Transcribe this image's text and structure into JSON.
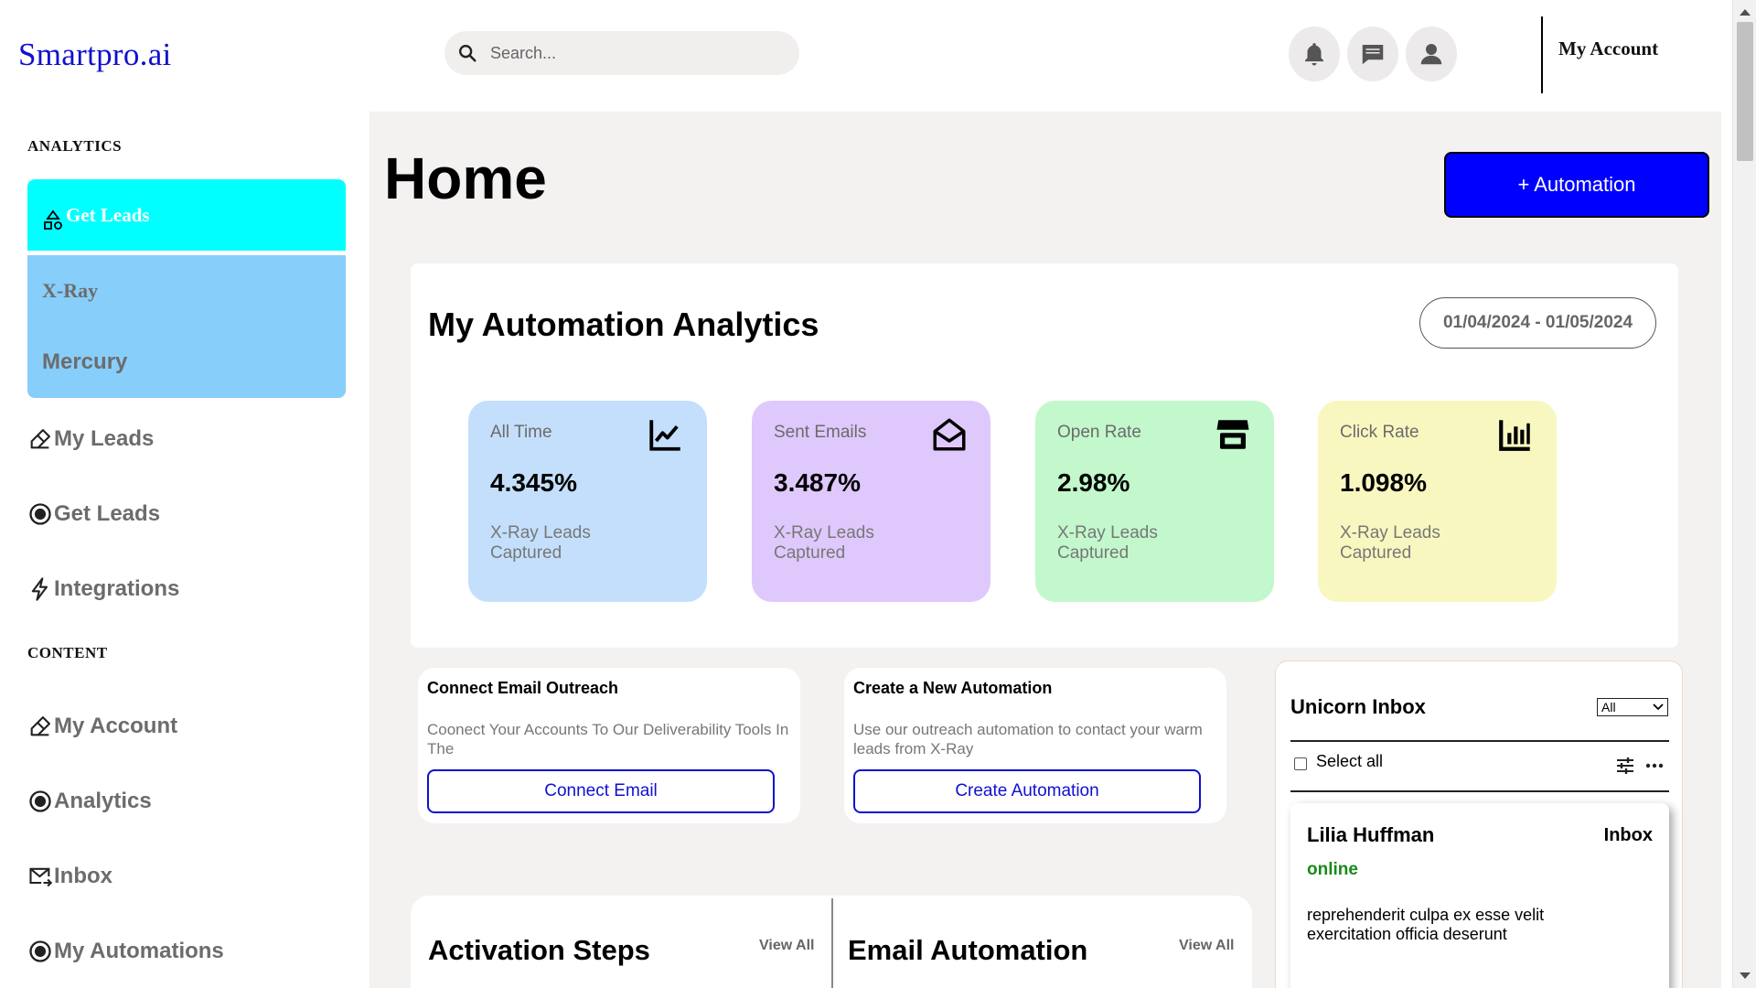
{
  "header": {
    "logo": "Smartpro.ai",
    "search_placeholder": "Search...",
    "account_label": "My Account",
    "icons": [
      "bell-icon",
      "chat-icon",
      "user-icon",
      "search-icon"
    ]
  },
  "sidebar": {
    "section_analytics": "ANALYTICS",
    "section_content": "CONTENT",
    "group": {
      "active": "Get Leads",
      "xray": "X-Ray",
      "mercury": "Mercury"
    },
    "analytics_items": [
      {
        "label": "My Leads",
        "icon": "eraser-icon"
      },
      {
        "label": "Get Leads",
        "icon": "radio-icon"
      },
      {
        "label": "Integrations",
        "icon": "lightning-icon"
      }
    ],
    "content_items": [
      {
        "label": "My Account",
        "icon": "eraser-icon"
      },
      {
        "label": "Analytics",
        "icon": "radio-icon"
      },
      {
        "label": "Inbox",
        "icon": "mail-forward-icon"
      },
      {
        "label": "My Automations",
        "icon": "radio-icon"
      }
    ]
  },
  "main": {
    "title": "Home",
    "automation_button": "+ Automation",
    "analytics": {
      "title": "My Automation Analytics",
      "date_range": "01/04/2024 - 01/05/2024",
      "cards": [
        {
          "label": "All Time",
          "value": "4.345%",
          "sub": "X-Ray Leads Captured",
          "color": "#c3dffc",
          "icon": "chart-line-icon"
        },
        {
          "label": "Sent Emails",
          "value": "3.487%",
          "sub": "X-Ray Leads Captured",
          "color": "#dfc8fc",
          "icon": "envelope-open-icon"
        },
        {
          "label": "Open Rate",
          "value": "2.98%",
          "sub": "X-Ray Leads Captured",
          "color": "#c2f8cc",
          "icon": "store-icon"
        },
        {
          "label": "Click Rate",
          "value": "1.098%",
          "sub": "X-Ray Leads Captured",
          "color": "#f9f7c0",
          "icon": "bar-chart-icon"
        }
      ]
    },
    "connect": {
      "title": "Connect Email Outreach",
      "desc": "Coonect Your Accounts To Our Deliverability Tools In The",
      "button": "Connect Email"
    },
    "create": {
      "title": "Create a New Automation",
      "desc": "Use our outreach automation to contact your warm leads from X-Ray",
      "button": "Create Automation"
    },
    "activation": {
      "title": "Activation Steps",
      "view_all": "View All"
    },
    "email_automation": {
      "title": "Email Automation",
      "view_all": "View All"
    },
    "inbox": {
      "title": "Unicorn Inbox",
      "filter": "All",
      "select_all": "Select all",
      "message": {
        "name": "Lilia Huffman",
        "folder": "Inbox",
        "status": "online",
        "body": "reprehenderit culpa ex esse velit exercitation officia deserunt"
      }
    }
  }
}
